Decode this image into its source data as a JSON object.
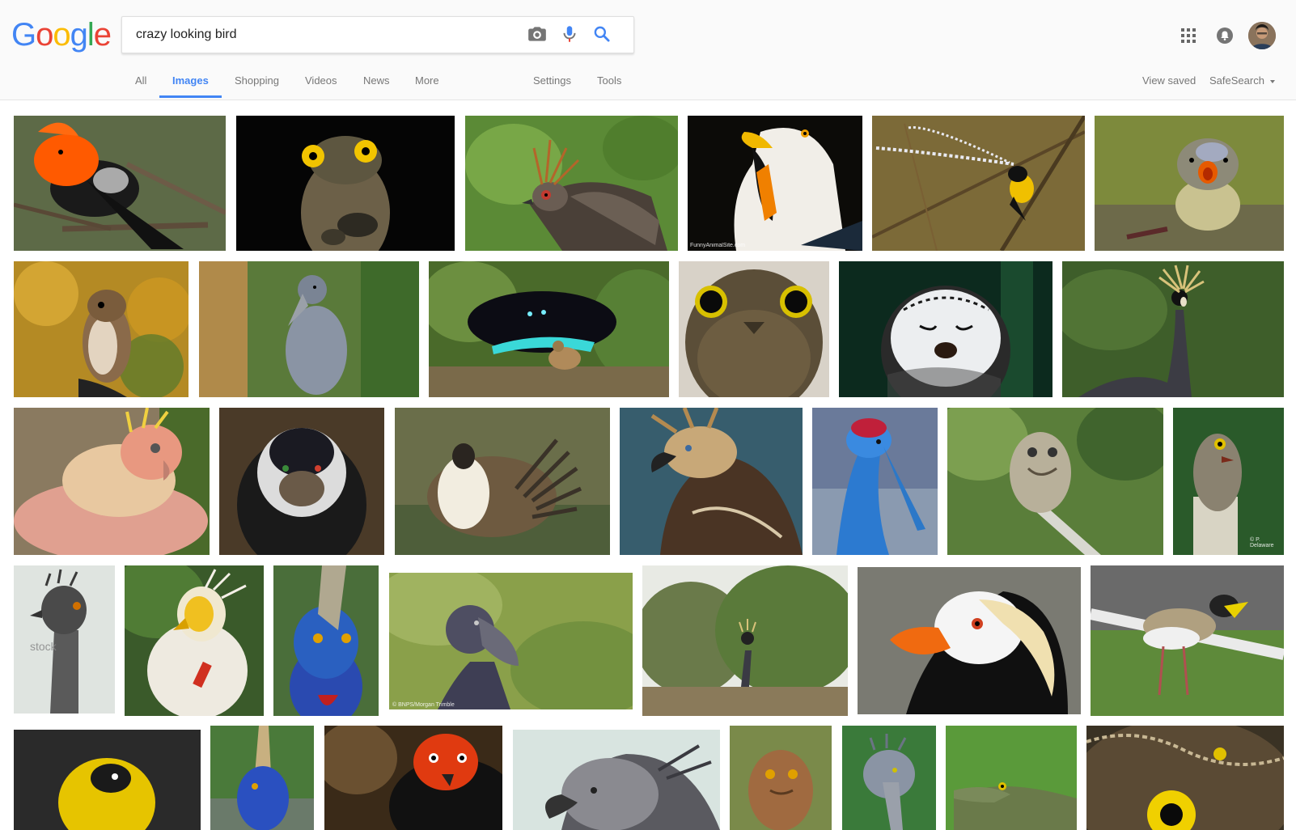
{
  "search": {
    "query": "crazy looking bird"
  },
  "nav": {
    "tabs": [
      {
        "label": "All"
      },
      {
        "label": "Images"
      },
      {
        "label": "Shopping"
      },
      {
        "label": "Videos"
      },
      {
        "label": "News"
      },
      {
        "label": "More"
      }
    ],
    "settings_label": "Settings",
    "tools_label": "Tools",
    "view_saved_label": "View saved",
    "safesearch_label": "SafeSearch"
  },
  "colors": {
    "accent": "#4285f4",
    "logo_blue": "#4285f4",
    "logo_red": "#ea4335",
    "logo_yellow": "#fbbc05",
    "logo_green": "#34a853"
  },
  "icons": {
    "camera": "camera-icon",
    "mic": "microphone-icon",
    "search": "search-icon",
    "apps": "apps-grid-icon",
    "notifications": "notifications-bell-icon",
    "avatar": "avatar"
  },
  "image_credits": {
    "tile_4": "FunnyAnimalSite.com",
    "tile_23": "© BNPS/Morgan Trimble",
    "tile_19": "© P. Delaware",
    "tile_20": "stock"
  }
}
